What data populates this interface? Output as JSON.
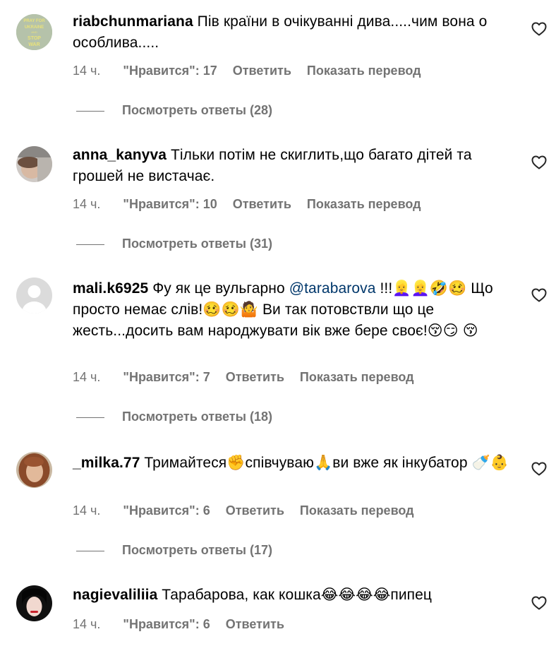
{
  "labels": {
    "likes_prefix": "\"Нравится\": ",
    "reply": "Ответить",
    "translate": "Показать перевод",
    "view_replies_prefix": "Посмотреть ответы "
  },
  "comments": [
    {
      "username": "riabchunmariana",
      "text": "Пів країни в очікуванні дива.....чим вона о особлива.....",
      "time": "14 ч.",
      "likes": "\"Нравится\": 17",
      "reply": "Ответить",
      "translate": "Показать перевод",
      "replies": "Посмотреть ответы (28)",
      "avatar_text": "PRAY FOR UKRAINE AND STOP WAR"
    },
    {
      "username": "anna_kanyva",
      "text": "Тільки потім не скиглить,що багато дітей та грошей не вистачає.",
      "time": "14 ч.",
      "likes": "\"Нравится\": 10",
      "reply": "Ответить",
      "translate": "Показать перевод",
      "replies": "Посмотреть ответы (31)"
    },
    {
      "username": "mali.k6925",
      "text_before": "Фу як це вульгарно ",
      "mention": "@tarabarova",
      "text_after": " !!!👱‍♀️👱‍♀️🤣🥴 Що просто немає слів!🥴🥴🤷 Ви так потовствли що це жесть...досить вам народжувати вік вже бере своє!😚😏 😚",
      "time": "14 ч.",
      "likes": "\"Нравится\": 7",
      "reply": "Ответить",
      "translate": "Показать перевод",
      "replies": "Посмотреть ответы (18)"
    },
    {
      "username": "_milka.77",
      "text": "Тримайтеся✊співчуваю🙏ви вже як інкубатор 🍼👶",
      "time": "14 ч.",
      "likes": "\"Нравится\": 6",
      "reply": "Ответить",
      "translate": "Показать перевод",
      "replies": "Посмотреть ответы (17)"
    },
    {
      "username": "nagievaliliia",
      "text": "Тарабарова, как кошка😂😂😂😂пипец",
      "time": "14 ч.",
      "likes": "\"Нравится\": 6",
      "reply": "Ответить"
    }
  ],
  "colors": {
    "text": "#000000",
    "meta": "#737373",
    "mention": "#00376b",
    "divider": "#737373"
  },
  "icons": [
    "heart-outline-icon",
    "avatar"
  ]
}
